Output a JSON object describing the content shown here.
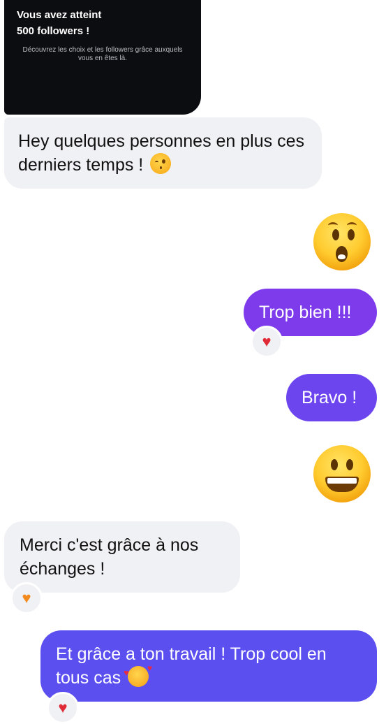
{
  "shared_card": {
    "title_line1": "Vous avez atteint",
    "title_line2": "500 followers !",
    "description": "Découvrez les choix et les followers grâce auxquels vous en êtes là."
  },
  "messages": [
    {
      "direction": "incoming",
      "text": "Hey quelques personnes en plus ces derniers temps !",
      "emoji": "winking-face-icon"
    },
    {
      "direction": "outgoing",
      "emoji": "hushed-face-icon",
      "large": true
    },
    {
      "direction": "outgoing",
      "text": "Trop bien !!!",
      "reaction": "♥"
    },
    {
      "direction": "outgoing",
      "text": "Bravo !"
    },
    {
      "direction": "outgoing",
      "emoji": "grinning-face-icon",
      "large": true
    },
    {
      "direction": "incoming",
      "text": "Merci c'est grâce à nos échanges !",
      "reaction": "♥"
    },
    {
      "direction": "outgoing",
      "text": "Et grâce a ton travail ! Trop cool en tous cas",
      "emoji": "smiling-face-with-hearts-icon",
      "reaction": "♥"
    }
  ],
  "colors": {
    "incoming_bubble": "#f0f1f4",
    "outgoing_purple": "#7d3bec",
    "outgoing_violet": "#6c45ee",
    "outgoing_indigo": "#5b4ff0",
    "heart_red": "#e02b36",
    "heart_orange": "#f28a1e",
    "card_bg": "#0c0d10"
  }
}
